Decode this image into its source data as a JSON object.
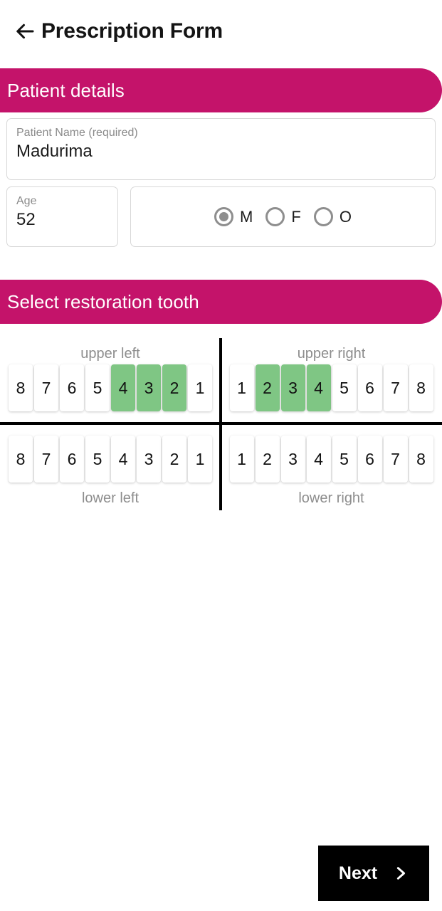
{
  "appbar": {
    "back_icon": "arrow-left-icon",
    "title": "Prescription Form"
  },
  "sections": {
    "patient": {
      "title": "Patient details"
    },
    "tooth": {
      "title": "Select restoration tooth"
    }
  },
  "patient_form": {
    "name_field": {
      "label": "Patient Name (required)",
      "value": "Madurima",
      "placeholder": "Patient Name (required)"
    },
    "age_field": {
      "label": "Age",
      "value": "52",
      "placeholder": "Age"
    },
    "gender": {
      "selected": "M",
      "options": [
        {
          "value": "M",
          "label": "M",
          "selected": true
        },
        {
          "value": "F",
          "label": "F",
          "selected": false
        },
        {
          "value": "O",
          "label": "O",
          "selected": false
        }
      ]
    }
  },
  "tooth_chart": {
    "labels": {
      "upper_left": "upper left",
      "upper_right": "upper right",
      "lower_left": "lower left",
      "lower_right": "lower right"
    },
    "selected_color": "#7fc684",
    "upper_left": [
      {
        "n": "8",
        "selected": false
      },
      {
        "n": "7",
        "selected": false
      },
      {
        "n": "6",
        "selected": false
      },
      {
        "n": "5",
        "selected": false
      },
      {
        "n": "4",
        "selected": true
      },
      {
        "n": "3",
        "selected": true
      },
      {
        "n": "2",
        "selected": true
      },
      {
        "n": "1",
        "selected": false
      }
    ],
    "upper_right": [
      {
        "n": "1",
        "selected": false
      },
      {
        "n": "2",
        "selected": true
      },
      {
        "n": "3",
        "selected": true
      },
      {
        "n": "4",
        "selected": true
      },
      {
        "n": "5",
        "selected": false
      },
      {
        "n": "6",
        "selected": false
      },
      {
        "n": "7",
        "selected": false
      },
      {
        "n": "8",
        "selected": false
      }
    ],
    "lower_left": [
      {
        "n": "8",
        "selected": false
      },
      {
        "n": "7",
        "selected": false
      },
      {
        "n": "6",
        "selected": false
      },
      {
        "n": "5",
        "selected": false
      },
      {
        "n": "4",
        "selected": false
      },
      {
        "n": "3",
        "selected": false
      },
      {
        "n": "2",
        "selected": false
      },
      {
        "n": "1",
        "selected": false
      }
    ],
    "lower_right": [
      {
        "n": "1",
        "selected": false
      },
      {
        "n": "2",
        "selected": false
      },
      {
        "n": "3",
        "selected": false
      },
      {
        "n": "4",
        "selected": false
      },
      {
        "n": "5",
        "selected": false
      },
      {
        "n": "6",
        "selected": false
      },
      {
        "n": "7",
        "selected": false
      },
      {
        "n": "8",
        "selected": false
      }
    ]
  },
  "footer": {
    "next_label": "Next",
    "next_icon": "chevron-right-icon"
  },
  "theme": {
    "accent_pink": "#c4136a",
    "selected_green": "#7fc684",
    "button_black": "#000000"
  }
}
